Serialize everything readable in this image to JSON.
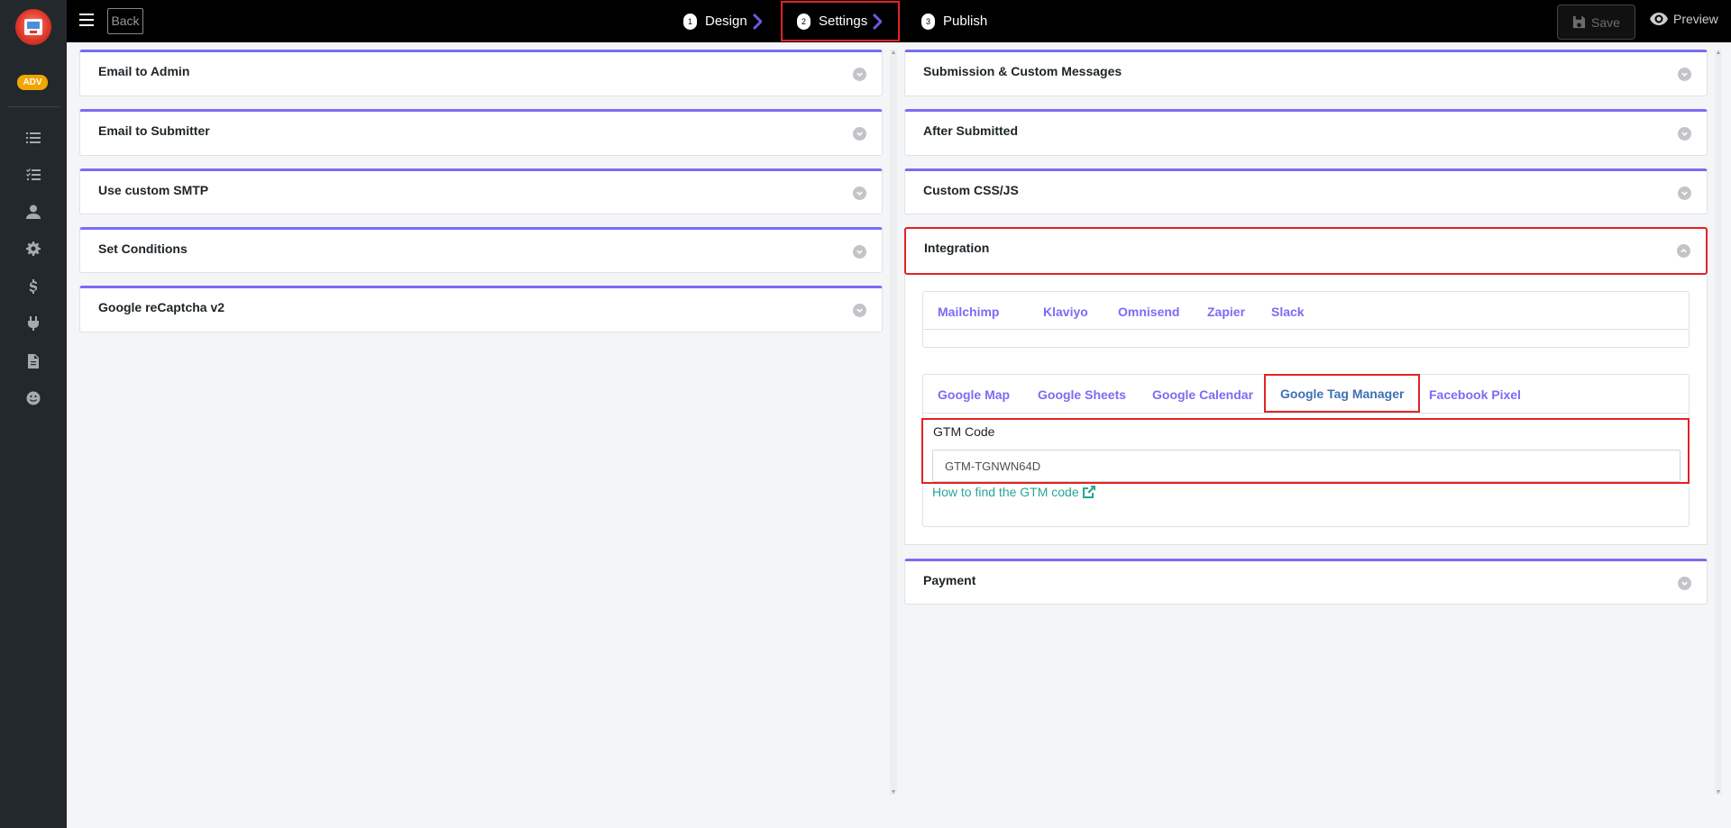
{
  "sidebar": {
    "badge": "ADV",
    "icons": [
      "list-icon",
      "checklist-icon",
      "user-icon",
      "gear-icon",
      "dollar-icon",
      "plug-icon",
      "document-icon",
      "smiley-icon"
    ]
  },
  "topbar": {
    "back_label": "Back",
    "steps": [
      {
        "num": "1",
        "label": "Design"
      },
      {
        "num": "2",
        "label": "Settings"
      },
      {
        "num": "3",
        "label": "Publish"
      }
    ],
    "save_label": "Save",
    "preview_label": "Preview"
  },
  "left_panels": [
    "Email to Admin",
    "Email to Submitter",
    "Use custom SMTP",
    "Set Conditions",
    "Google reCaptcha v2"
  ],
  "right_panels": {
    "submission": "Submission & Custom Messages",
    "after_submitted": "After Submitted",
    "custom_css": "Custom CSS/JS",
    "integration": "Integration",
    "payment": "Payment"
  },
  "integration": {
    "tabs_row1": [
      "Mailchimp",
      "Klaviyo",
      "Omnisend",
      "Zapier",
      "Slack"
    ],
    "tabs_row2": [
      "Google Map",
      "Google Sheets",
      "Google Calendar",
      "Google Tag Manager",
      "Facebook Pixel"
    ],
    "active_tab": "Google Tag Manager",
    "gtm_label": "GTM Code",
    "gtm_value": "GTM-TGNWN64D",
    "help_link": "How to find the GTM code"
  },
  "colors": {
    "accent": "#7b6cf5",
    "highlight": "#e02424",
    "link": "#26a69a",
    "sidebar": "#23282d",
    "badge": "#f0a500"
  }
}
